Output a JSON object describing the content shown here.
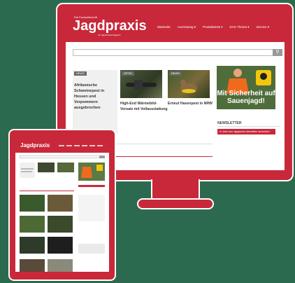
{
  "monitor": {
    "header": {
      "logo_prefix": "Die Fachzeitschrift",
      "logo": "Jagdpraxis",
      "logo_tagline": "Ihr Jagd-Praxis-Magazin",
      "nav": [
        "Startseite",
        "Ausrüstung ▾",
        "Produkttests ▾",
        "DAS Thema ▾",
        "Service ▾"
      ]
    },
    "search": {
      "placeholder": "",
      "button_icon": "search-icon"
    },
    "articles": [
      {
        "tag": "NEWS",
        "title": "Afrikanische Schweinepest in Hessen und Vorpommern ausgebrochen"
      },
      {
        "tag": "OPTIK",
        "title": "High-End Wärmebild-Vorsatz mit Vollausstattung"
      },
      {
        "tag": "NEWS",
        "title": "Erneut Hasenpest in NRW"
      }
    ],
    "ad": {
      "text": "Mit Sicherheit auf Sauenjagd!"
    },
    "newsletter": {
      "title": "NEWSLETTER",
      "button": "✉ Jetzt zum Jagdpraxis-Newsletter anmelden!"
    }
  },
  "tablet": {
    "logo": "Jagdpraxis"
  },
  "colors": {
    "brand_red": "#c8283a",
    "background": "#2c6a4f"
  }
}
